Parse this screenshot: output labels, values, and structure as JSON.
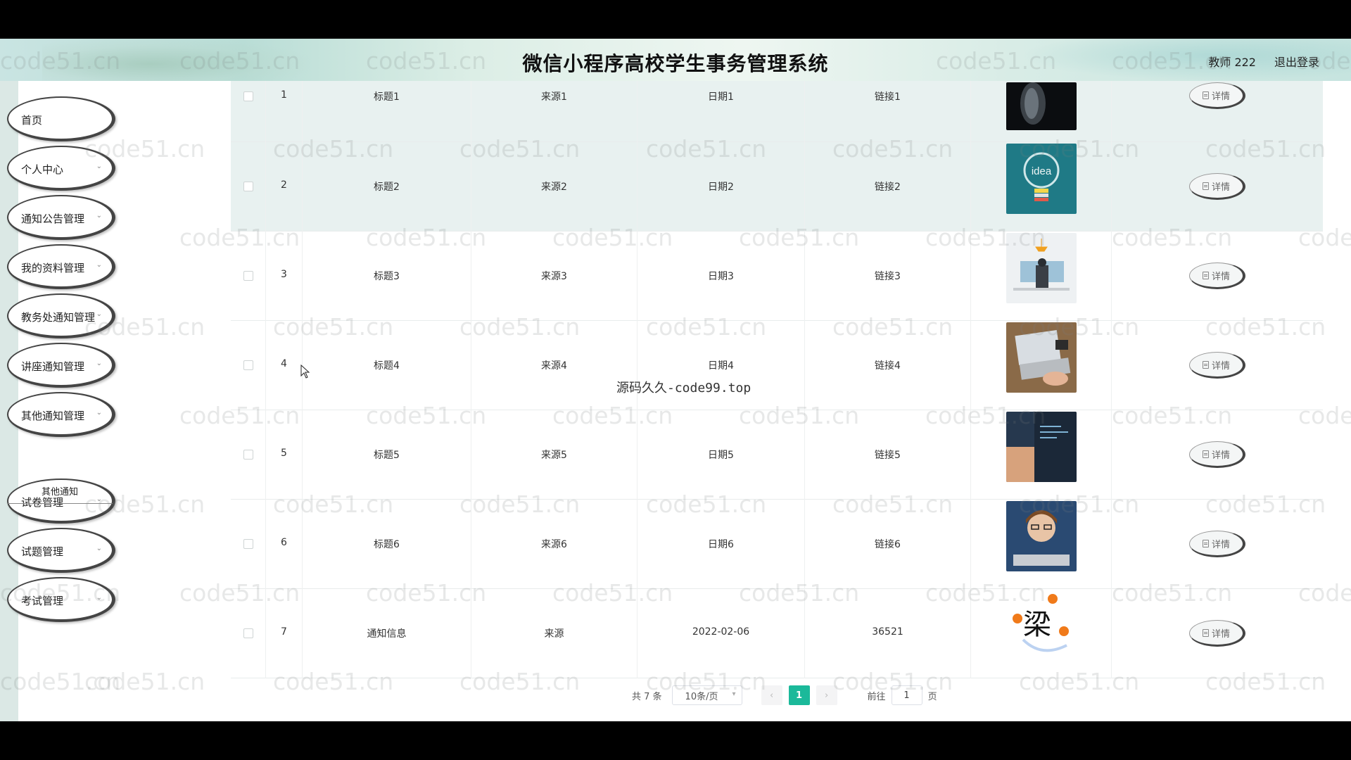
{
  "header": {
    "title": "微信小程序高校学生事务管理系统",
    "user": "教师 222",
    "logout": "退出登录"
  },
  "sidebar": {
    "items": [
      {
        "label": "首页",
        "has_arrow": false
      },
      {
        "label": "个人中心",
        "has_arrow": true
      },
      {
        "label": "通知公告管理",
        "has_arrow": true
      },
      {
        "label": "我的资料管理",
        "has_arrow": true
      },
      {
        "label": "教务处通知管理",
        "has_arrow": true
      },
      {
        "label": "讲座通知管理",
        "has_arrow": true
      },
      {
        "label": "其他通知管理",
        "has_arrow": true
      },
      {
        "label": "试卷管理",
        "has_arrow": true
      },
      {
        "label": "试题管理",
        "has_arrow": true
      },
      {
        "label": "考试管理",
        "has_arrow": true
      }
    ],
    "submenu": "其他通知"
  },
  "table": {
    "rows": [
      {
        "index": "1",
        "title": "标题1",
        "source": "来源1",
        "date": "日期1",
        "link": "链接1",
        "image": "robot-face"
      },
      {
        "index": "2",
        "title": "标题2",
        "source": "来源2",
        "date": "日期2",
        "link": "链接2",
        "image": "idea-lightbulb"
      },
      {
        "index": "3",
        "title": "标题3",
        "source": "来源3",
        "date": "日期3",
        "link": "链接3",
        "image": "office-desk"
      },
      {
        "index": "4",
        "title": "标题4",
        "source": "来源4",
        "date": "日期4",
        "link": "链接4",
        "image": "laptop-hands"
      },
      {
        "index": "5",
        "title": "标题5",
        "source": "来源5",
        "date": "日期5",
        "link": "链接5",
        "image": "laptop-code"
      },
      {
        "index": "6",
        "title": "标题6",
        "source": "来源6",
        "date": "日期6",
        "link": "链接6",
        "image": "child-computer"
      },
      {
        "index": "7",
        "title": "通知信息",
        "source": "来源",
        "date": "2022-02-06",
        "link": "36521",
        "image": "calligraphy-liang"
      }
    ],
    "detail_label": "详情",
    "detail_icon": "document-icon",
    "highlight_color": "#e8f1f0"
  },
  "image_text": {
    "idea": "idea",
    "liang": "梁"
  },
  "pagination": {
    "total": "共 7 条",
    "page_size": "10条/页",
    "current_page": "1",
    "goto_label": "前往",
    "goto_value": "1",
    "page_unit": "页",
    "accent": "#1bb99a"
  },
  "overlay": "源码久久-code99.top",
  "watermark": "code51.cn"
}
